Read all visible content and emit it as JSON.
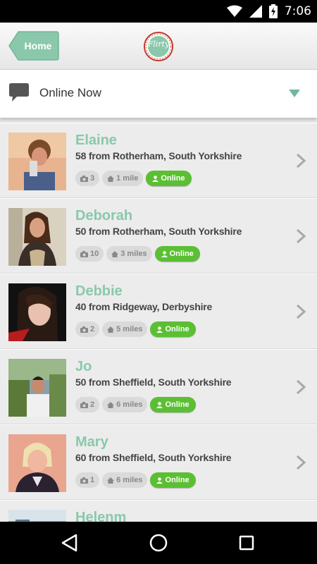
{
  "status_bar": {
    "time": "7:06",
    "icons": [
      "wifi-icon",
      "signal-icon",
      "battery-charging-icon"
    ]
  },
  "header": {
    "home_label": "Home",
    "logo_text": "Flirty",
    "colors": {
      "home": "#8ac8ac",
      "logo_red": "#c0392b"
    }
  },
  "filter": {
    "label": "Online Now",
    "icon": "chat-bubble-icon",
    "accent": "#6fb89c"
  },
  "members": [
    {
      "name": "Elaine",
      "details": "58 from Rotherham, South Yorkshire",
      "photos": "3",
      "distance": "1 mile",
      "status": "Online"
    },
    {
      "name": "Deborah",
      "details": "50 from Rotherham, South Yorkshire",
      "photos": "10",
      "distance": "3 miles",
      "status": "Online"
    },
    {
      "name": "Debbie",
      "details": "40 from Ridgeway, Derbyshire",
      "photos": "2",
      "distance": "5 miles",
      "status": "Online"
    },
    {
      "name": "Jo",
      "details": "50 from Sheffield, South Yorkshire",
      "photos": "2",
      "distance": "6 miles",
      "status": "Online"
    },
    {
      "name": "Mary",
      "details": "60 from Sheffield, South Yorkshire",
      "photos": "1",
      "distance": "6 miles",
      "status": "Online"
    },
    {
      "name": "Helenm",
      "details": "",
      "photos": "",
      "distance": "",
      "status": ""
    }
  ],
  "nav": [
    "back-icon",
    "home-circle-icon",
    "recents-icon"
  ]
}
